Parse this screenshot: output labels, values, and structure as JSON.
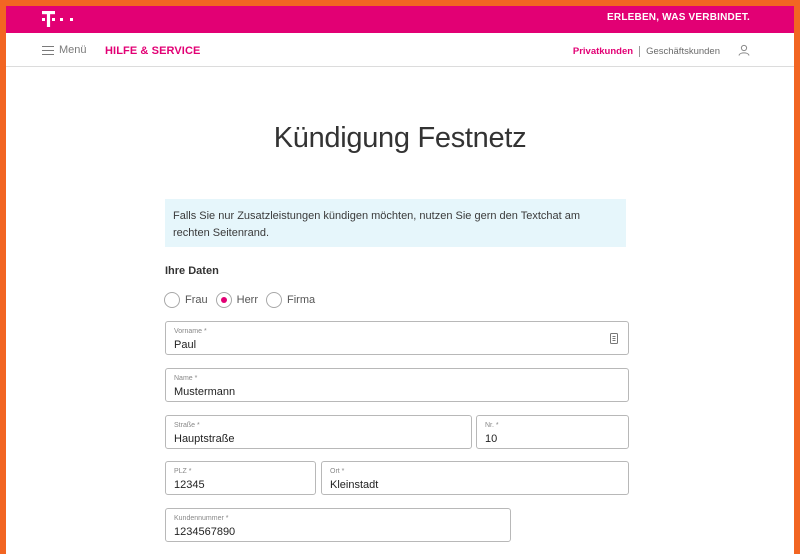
{
  "colors": {
    "brand": "#e20074",
    "info_bg": "#e6f6fb",
    "page_frame": "#f26522"
  },
  "topbar": {
    "logo": "T · ·",
    "tagline": "ERLEBEN, WAS VERBINDET."
  },
  "nav": {
    "menu_label": "Menü",
    "section_title": "HILFE & SERVICE",
    "segments": [
      "Privatkunden",
      "Geschäftskunden"
    ],
    "user_icon": "user-icon"
  },
  "page": {
    "title": "Kündigung Festnetz",
    "info_text": "Falls Sie nur Zusatzleistungen kündigen möchten, nutzen Sie gern den Textchat am rechten Seitenrand."
  },
  "form": {
    "section_label": "Ihre Daten",
    "salutation": {
      "options": [
        "Frau",
        "Herr",
        "Firma"
      ],
      "selected": "Herr"
    },
    "fields": {
      "vorname": {
        "label": "Vorname *",
        "value": "Paul"
      },
      "name": {
        "label": "Name *",
        "value": "Mustermann"
      },
      "strasse": {
        "label": "Straße *",
        "value": "Hauptstraße"
      },
      "nr": {
        "label": "Nr. *",
        "value": "10"
      },
      "plz": {
        "label": "PLZ *",
        "value": "12345"
      },
      "ort": {
        "label": "Ort *",
        "value": "Kleinstadt"
      },
      "kundennummer": {
        "label": "Kundennummer *",
        "value": "1234567890"
      }
    }
  }
}
